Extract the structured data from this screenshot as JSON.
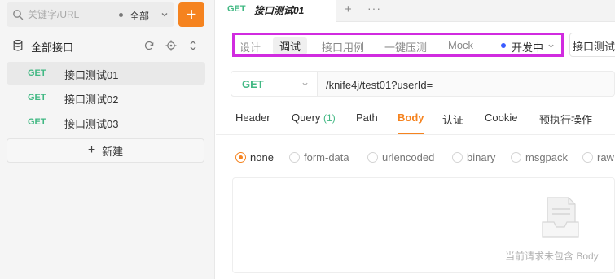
{
  "sidebar": {
    "search": {
      "placeholder": "关键字/URL"
    },
    "scope": {
      "label": "全部"
    },
    "add_button": {
      "label": "+"
    },
    "group": {
      "title": "全部接口"
    },
    "items": [
      {
        "method": "GET",
        "name": "接口测试01"
      },
      {
        "method": "GET",
        "name": "接口测试02"
      },
      {
        "method": "GET",
        "name": "接口测试03"
      }
    ],
    "new_button": {
      "icon": "+",
      "label": "新建"
    }
  },
  "tabbar": {
    "tab": {
      "method": "GET",
      "name": "接口测试01"
    },
    "add": "+",
    "more": "···"
  },
  "mode_bar": {
    "items": [
      "设计",
      "调试",
      "接口用例",
      "一键压测",
      "Mock"
    ],
    "active": "调试",
    "environment": "开发中",
    "highlight_color": "#d12be0"
  },
  "extra_mode": {
    "label": "接口测试"
  },
  "request": {
    "method": "GET",
    "url": "/knife4j/test01?userId="
  },
  "request_tabs": {
    "header": "Header",
    "query": "Query",
    "query_count": "(1)",
    "path": "Path",
    "body": "Body",
    "auth": "认证",
    "cookie": "Cookie",
    "pre": "预执行操作"
  },
  "body_types": {
    "none": "none",
    "form_data": "form-data",
    "urlencoded": "urlencoded",
    "binary": "binary",
    "msgpack": "msgpack",
    "raw": "raw"
  },
  "body_panel": {
    "empty_text": "当前请求未包含 Body"
  },
  "colors": {
    "accent": "#f5831f",
    "method_get": "#41b883"
  }
}
